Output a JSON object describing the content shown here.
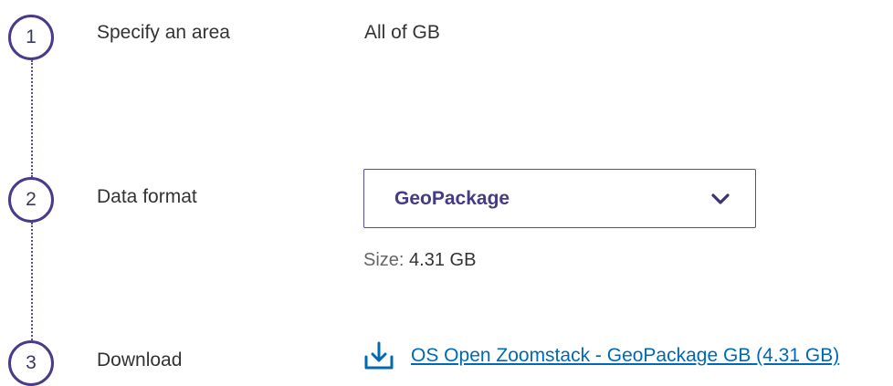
{
  "steps": [
    {
      "number": "1",
      "label": "Specify an area"
    },
    {
      "number": "2",
      "label": "Data format"
    },
    {
      "number": "3",
      "label": "Download"
    }
  ],
  "area": {
    "value": "All of GB"
  },
  "format_select": {
    "selected": "GeoPackage"
  },
  "size": {
    "prefix": "Size:",
    "value": "4.31 GB"
  },
  "download": {
    "link_text": "OS Open Zoomstack - GeoPackage GB (4.31 GB)"
  },
  "icons": {
    "format_dropdown": "chevron-down-icon",
    "download": "download-icon"
  },
  "colors": {
    "step_circle": "#4b3a8c",
    "select_text": "#453a86",
    "link": "#0069b4"
  }
}
